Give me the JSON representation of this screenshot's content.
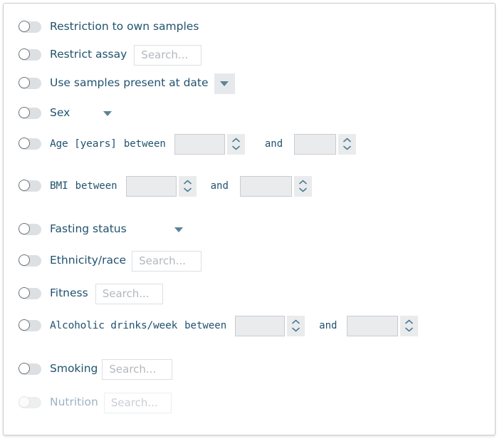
{
  "panel": {
    "accent_text": "#21536e",
    "toggle_track": "#dde0e3",
    "field_fill": "#e9ebed",
    "placeholder_color": "#b3b8bd",
    "arrow_color": "#5d8298"
  },
  "common": {
    "search_placeholder": "Search...",
    "between_label": "between",
    "and_label": "and",
    "toggle_icon": "toggle-switch-off-icon",
    "chevron_up_icon": "chevron-up-icon",
    "chevron_down_icon": "chevron-down-icon",
    "caret_down_icon": "caret-down-icon"
  },
  "filters": [
    {
      "key": "restriction-to-own-samples",
      "label": "Restriction to own samples",
      "enabled": true,
      "toggle_on": false,
      "control": "none"
    },
    {
      "key": "restrict-assay",
      "label": "Restrict assay",
      "enabled": true,
      "toggle_on": false,
      "control": "search",
      "value": "",
      "placeholder": "Search..."
    },
    {
      "key": "use-samples-present-at-date",
      "label": "Use samples present at date",
      "enabled": true,
      "toggle_on": false,
      "control": "dropdown-button",
      "value": ""
    },
    {
      "key": "sex",
      "label": "Sex",
      "enabled": true,
      "toggle_on": false,
      "control": "dropdown-plain",
      "value": ""
    },
    {
      "key": "age-years",
      "label": "Age [years]",
      "enabled": true,
      "toggle_on": false,
      "control": "range",
      "between_label": "between",
      "and_label": "and",
      "min_value": "",
      "max_value": ""
    },
    {
      "key": "bmi",
      "label": "BMI",
      "enabled": true,
      "toggle_on": false,
      "control": "range",
      "between_label": "between",
      "and_label": "and",
      "min_value": "",
      "max_value": ""
    },
    {
      "key": "fasting-status",
      "label": "Fasting status",
      "enabled": true,
      "toggle_on": false,
      "control": "dropdown-plain",
      "value": ""
    },
    {
      "key": "ethnicity-race",
      "label": "Ethnicity/race",
      "enabled": true,
      "toggle_on": false,
      "control": "search",
      "value": "",
      "placeholder": "Search..."
    },
    {
      "key": "fitness",
      "label": "Fitness",
      "enabled": true,
      "toggle_on": false,
      "control": "search",
      "value": "",
      "placeholder": "Search..."
    },
    {
      "key": "alcoholic-drinks-per-week",
      "label": "Alcoholic drinks/week",
      "enabled": true,
      "toggle_on": false,
      "control": "range",
      "between_label": "between",
      "and_label": "and",
      "min_value": "",
      "max_value": ""
    },
    {
      "key": "smoking",
      "label": "Smoking",
      "enabled": true,
      "toggle_on": false,
      "control": "search",
      "value": "",
      "placeholder": "Search..."
    },
    {
      "key": "nutrition",
      "label": "Nutrition",
      "enabled": false,
      "toggle_on": false,
      "control": "search",
      "value": "",
      "placeholder": "Search..."
    }
  ]
}
